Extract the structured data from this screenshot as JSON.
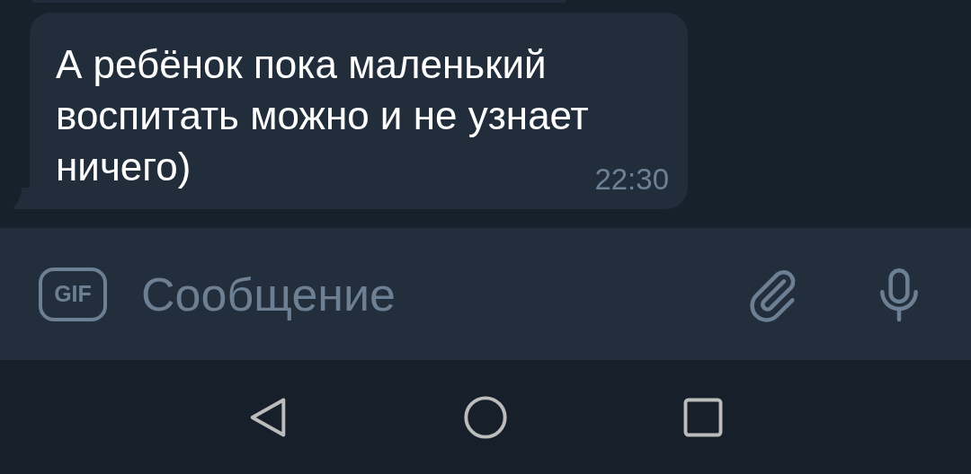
{
  "messages": [
    {
      "kind": "cut"
    },
    {
      "kind": "text",
      "text": "А ребёнок пока маленький воспитать можно и не узнает ничего)",
      "time": "22:30"
    }
  ],
  "composer": {
    "gif_label": "GIF",
    "placeholder": "Сообщение"
  },
  "nav_bar": {
    "buttons": [
      {
        "kind": "back"
      },
      {
        "kind": "home"
      },
      {
        "kind": "recents"
      }
    ]
  }
}
